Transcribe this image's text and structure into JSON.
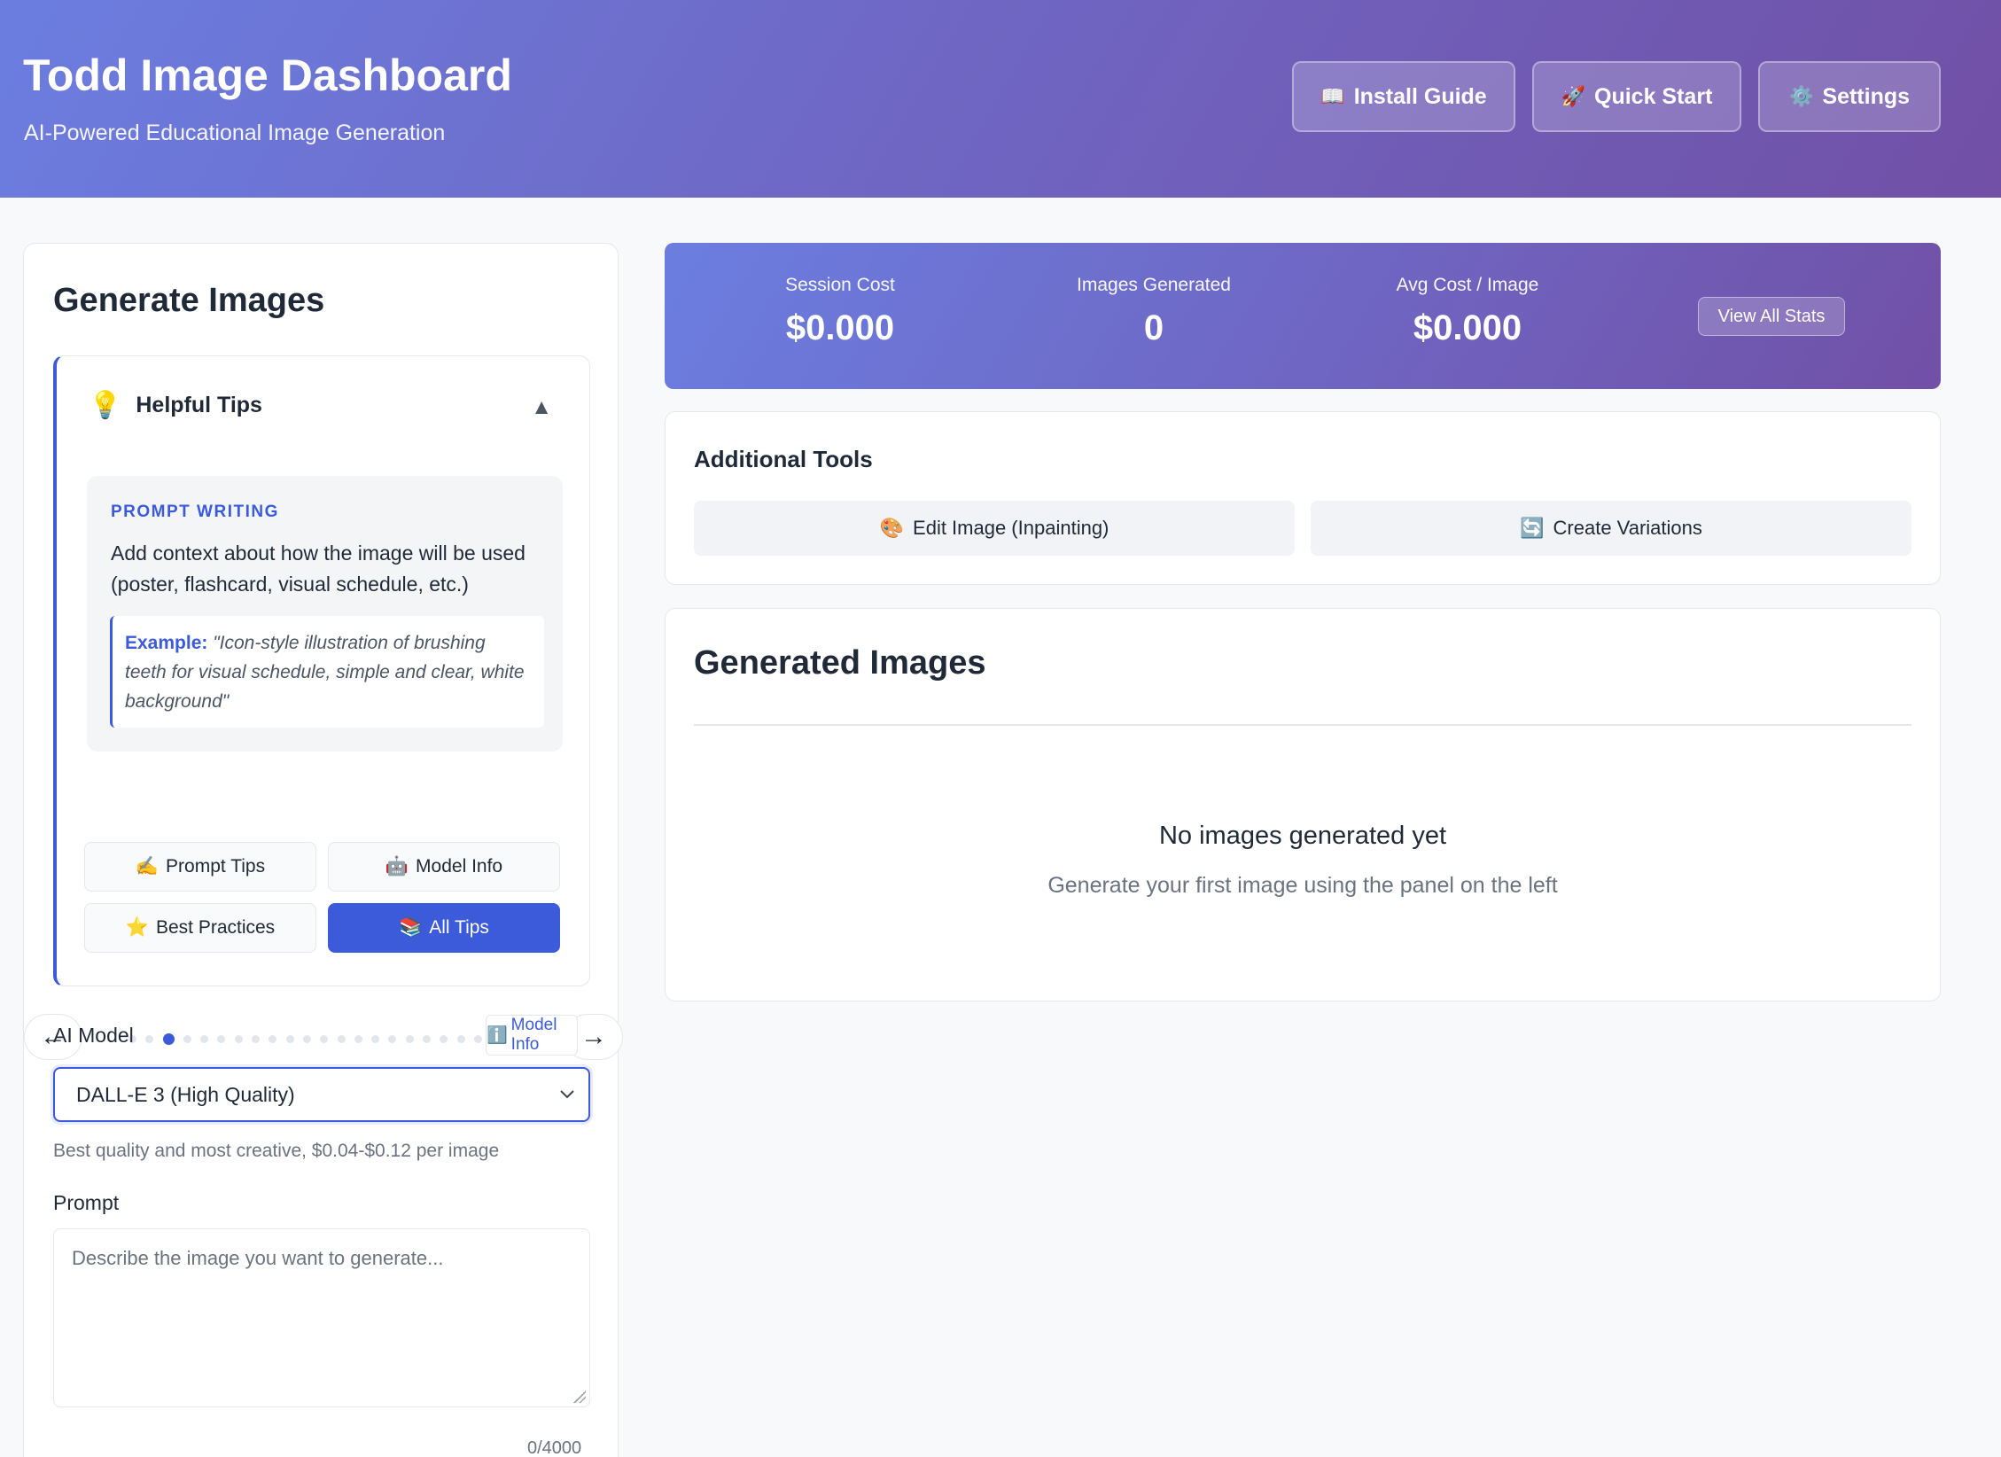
{
  "header": {
    "title": "Todd Image Dashboard",
    "subtitle": "AI-Powered Educational Image Generation",
    "buttons": [
      {
        "icon": "📖",
        "label": "Install Guide"
      },
      {
        "icon": "🚀",
        "label": "Quick Start"
      },
      {
        "icon": "⚙️",
        "label": "Settings"
      }
    ]
  },
  "left_panel": {
    "title": "Generate Images",
    "tips": {
      "header_icon": "💡",
      "header_label": "Helpful Tips",
      "collapse_icon": "▲",
      "category": "PROMPT WRITING",
      "text": "Add context about how the image will be used (poster, flashcard, visual schedule, etc.)",
      "example_label": "Example:",
      "example_text": "\"Icon-style illustration of brushing teeth for visual schedule, simple and clear, white background\"",
      "prev_icon": "←",
      "next_icon": "→",
      "dot_count": 27,
      "active_dot_index": 2,
      "categories": [
        {
          "icon": "✍️",
          "label": "Prompt Tips",
          "active": false
        },
        {
          "icon": "🤖",
          "label": "Model Info",
          "active": false
        },
        {
          "icon": "⭐",
          "label": "Best Practices",
          "active": false
        },
        {
          "icon": "📚",
          "label": "All Tips",
          "active": true
        }
      ]
    },
    "model": {
      "label": "AI Model",
      "info_button_icon": "ℹ️",
      "info_button_label": "Model Info",
      "selected": "DALL-E 3 (High Quality)",
      "hint": "Best quality and most creative, $0.04-$0.12 per image"
    },
    "prompt": {
      "label": "Prompt",
      "placeholder": "Describe the image you want to generate...",
      "counter": "0/4000"
    }
  },
  "stats": {
    "items": [
      {
        "label": "Session Cost",
        "value": "$0.000"
      },
      {
        "label": "Images Generated",
        "value": "0"
      },
      {
        "label": "Avg Cost / Image",
        "value": "$0.000"
      }
    ],
    "view_all_label": "View All Stats"
  },
  "tools": {
    "title": "Additional Tools",
    "buttons": [
      {
        "icon": "🎨",
        "label": "Edit Image (Inpainting)"
      },
      {
        "icon": "🔄",
        "label": "Create Variations"
      }
    ]
  },
  "generated": {
    "title": "Generated Images",
    "empty_title": "No images generated yet",
    "empty_subtitle": "Generate your first image using the panel on the left"
  },
  "colors": {
    "accent": "#3b5bdb",
    "header_gradient_start": "#6b7ee0",
    "header_gradient_end": "#7150a6"
  }
}
